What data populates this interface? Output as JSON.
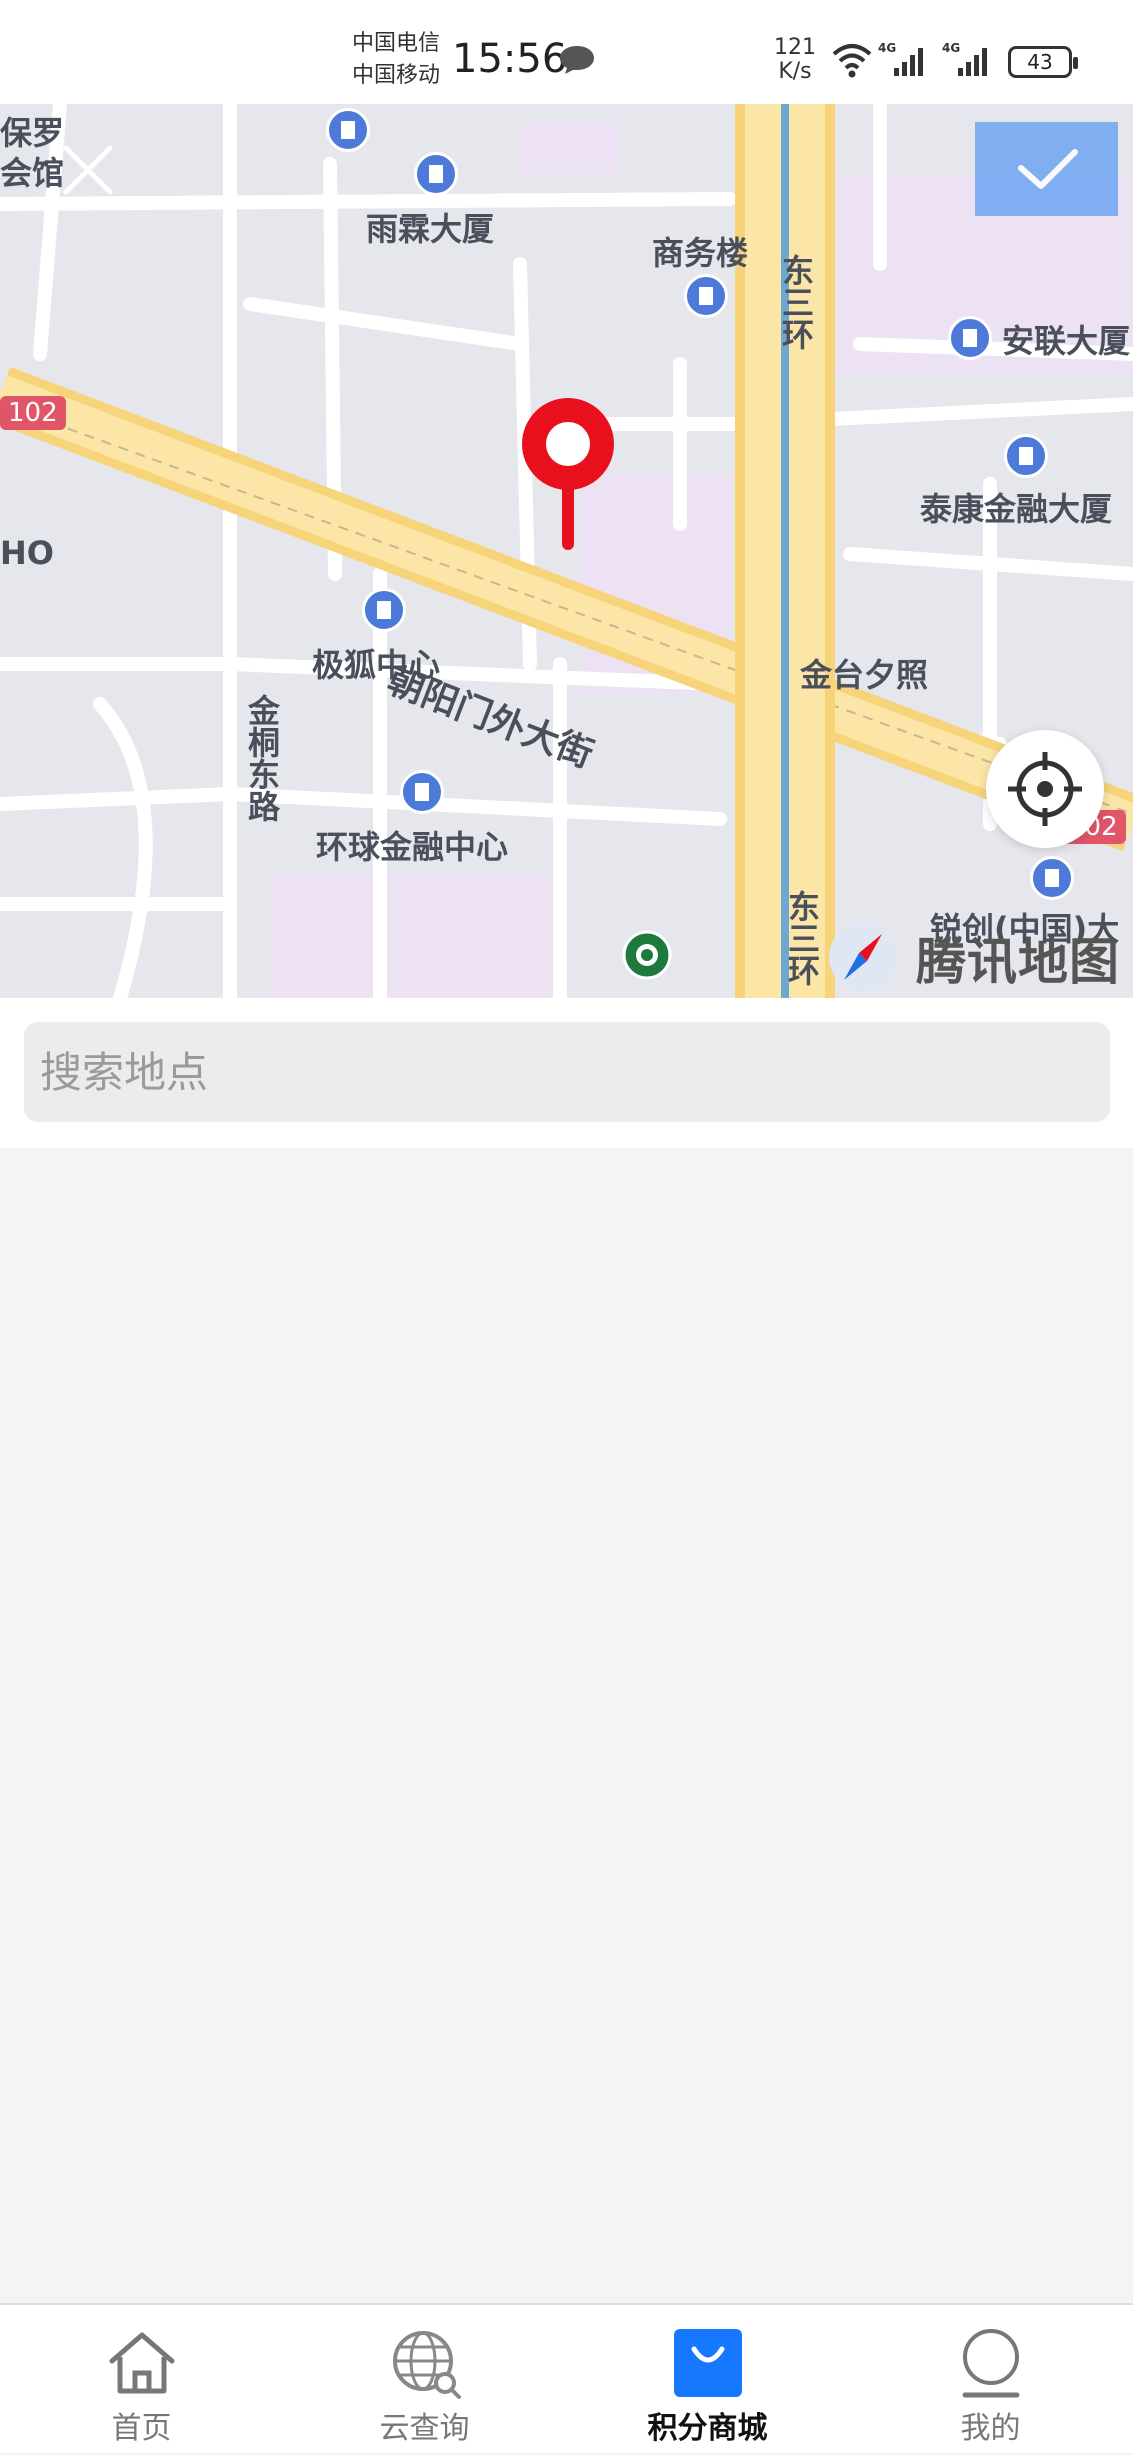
{
  "status_bar": {
    "carrier_1": "中国电信",
    "carrier_2": "中国移动",
    "time": "15:56",
    "net_speed_value": "121",
    "net_speed_unit": "K/s",
    "signal_1_label": "4G",
    "signal_2_label": "4G",
    "battery": "43"
  },
  "map": {
    "labels": {
      "baoluo_1": "保罗",
      "baoluo_2": "会馆",
      "yulin": "雨霖大厦",
      "shangwulou": "商务楼",
      "dongsanhuan_top": "东三环",
      "anlian": "安联大厦",
      "taikang": "泰康金融大厦",
      "chaoyangmen": "朝阳门外大街",
      "jihu": "极狐中心",
      "jintaixizhao": "金台夕照",
      "jintongdonglu": "金桐东路",
      "huanqiu": "环球金融中心",
      "dongsanhuan_bottom": "东三环",
      "ruijian": "锐创(中国)大",
      "ho": "HO",
      "road_102_left": "102",
      "road_102_right": "102"
    },
    "logo": "腾讯地图",
    "accent_color": "#e8101c"
  },
  "search": {
    "placeholder": "搜索地点",
    "value": ""
  },
  "tab_bar": {
    "active_color": "#1677ff",
    "tabs": [
      {
        "label": "首页",
        "icon": "home-icon"
      },
      {
        "label": "云查询",
        "icon": "globe-search-icon"
      },
      {
        "label": "积分商城",
        "icon": "shopping-bag-icon"
      },
      {
        "label": "我的",
        "icon": "user-icon"
      }
    ]
  }
}
